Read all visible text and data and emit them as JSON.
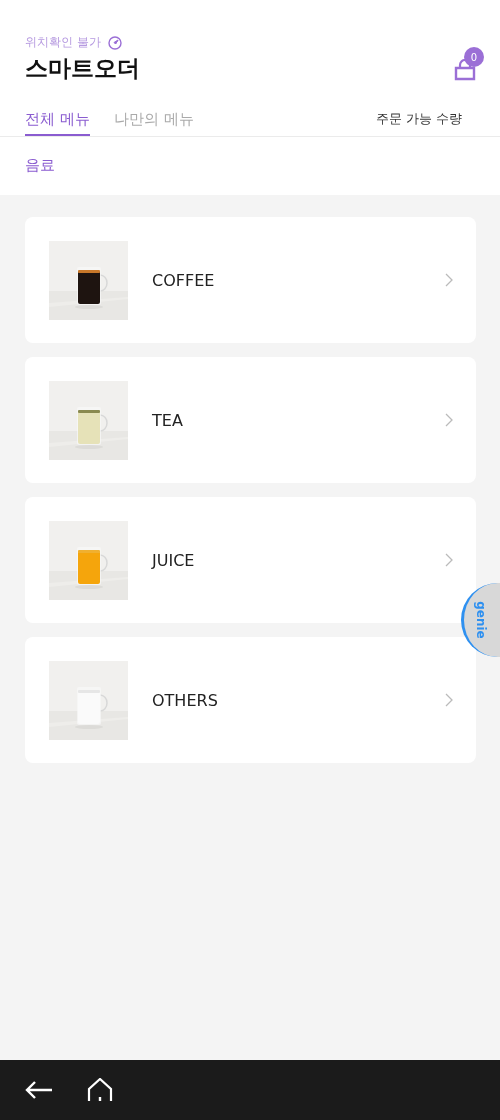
{
  "header": {
    "location_status": "위치확인 불가",
    "title": "스마트오더",
    "cart_count": "0"
  },
  "tabs": [
    {
      "label": "전체 메뉴",
      "selected": true
    },
    {
      "label": "나만의 메뉴",
      "selected": false
    }
  ],
  "order_qty_label": "주문 가능 수량",
  "category": "음료",
  "menu_items": [
    {
      "name": "COFFEE"
    },
    {
      "name": "TEA"
    },
    {
      "name": "JUICE"
    },
    {
      "name": "OTHERS"
    }
  ],
  "genie_button": "genie"
}
